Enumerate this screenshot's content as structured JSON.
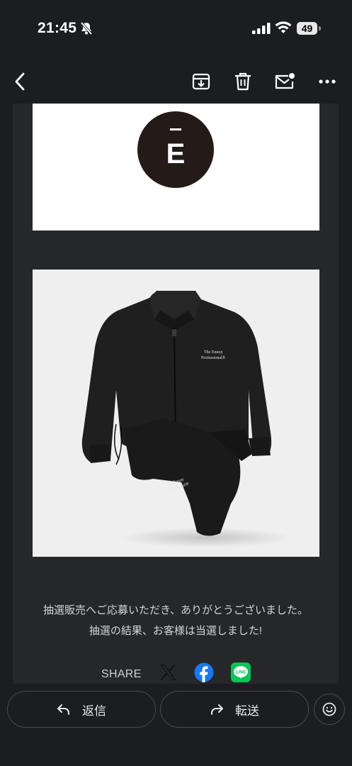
{
  "status_bar": {
    "time": "21:45",
    "battery": "49"
  },
  "toolbar": {
    "back_icon": "chevron-left-icon",
    "archive_icon": "archive-icon",
    "delete_icon": "trash-icon",
    "mark_unread_icon": "mark-unread-icon",
    "more_icon": "more-horizontal-icon"
  },
  "email": {
    "logo_letter": "E",
    "product_print": "The Ennoy Professional®",
    "message_line1": "抽選販売へご応募いただき、ありがとうございました。",
    "message_line2": "抽選の結果、お客様は当選しました!",
    "share_label": "SHARE"
  },
  "share_icons": [
    "x-icon",
    "facebook-icon",
    "line-icon"
  ],
  "line_badge": "LINE",
  "colors": {
    "background": "#1c1d20",
    "card": "#262729",
    "facebook": "#1877f2",
    "line": "#06c755"
  },
  "actions": {
    "reply_label": "返信",
    "forward_label": "転送"
  }
}
